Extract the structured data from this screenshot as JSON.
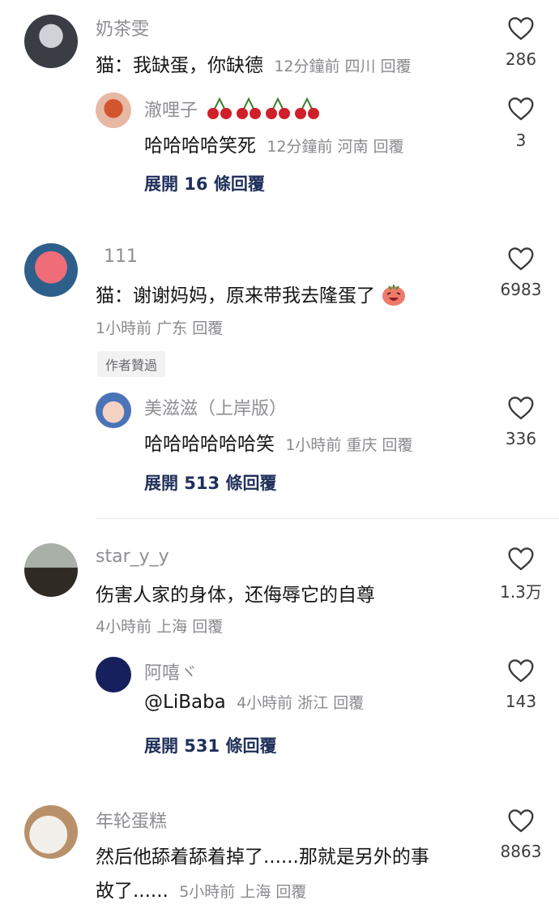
{
  "comments": [
    {
      "user": "奶茶雯",
      "text": "猫：我缺蛋，你缺德",
      "time": "12分鐘前",
      "location": "四川",
      "reply": "回覆",
      "likes": "286",
      "sub_reply": {
        "user": "澈哩子",
        "text": "哈哈哈哈笑死",
        "time": "12分鐘前",
        "location": "河南",
        "reply": "回覆",
        "likes": "3"
      },
      "expand": "展開 16 條回覆"
    },
    {
      "user": "111",
      "text": "猫：谢谢妈妈，原来带我去隆蛋了",
      "time": "1小時前",
      "location": "广东",
      "reply": "回覆",
      "likes": "6983",
      "badge": "作者贊過",
      "sub_reply": {
        "user": "美滋滋（上岸版）",
        "text": "哈哈哈哈哈哈笑",
        "time": "1小時前",
        "location": "重庆",
        "reply": "回覆",
        "likes": "336"
      },
      "expand": "展開 513 條回覆"
    },
    {
      "user": "star_y_y",
      "text": "伤害人家的身体，还侮辱它的自尊",
      "time": "4小時前",
      "location": "上海",
      "reply": "回覆",
      "likes": "1.3万",
      "sub_reply": {
        "user": "阿嘻ヾ",
        "text": "@LiBaba",
        "time": "4小時前",
        "location": "浙江",
        "reply": "回覆",
        "likes": "143"
      },
      "expand": "展開 531 條回覆"
    },
    {
      "user": "年轮蛋糕",
      "text_line1": "然后他舔着舔着掉了......那就是另外的事",
      "text_line2": "故了......",
      "time": "5小時前",
      "location": "上海",
      "reply": "回覆",
      "likes": "8863"
    }
  ],
  "icons": {
    "like": "heart-outline-icon",
    "cherry": "cherry-emoji-icon",
    "laugh": "laughing-emoji-icon"
  },
  "colors": {
    "expand_text": "#1f2f5a",
    "meta_text": "#8a8a8e",
    "username": "#8e8e93"
  }
}
